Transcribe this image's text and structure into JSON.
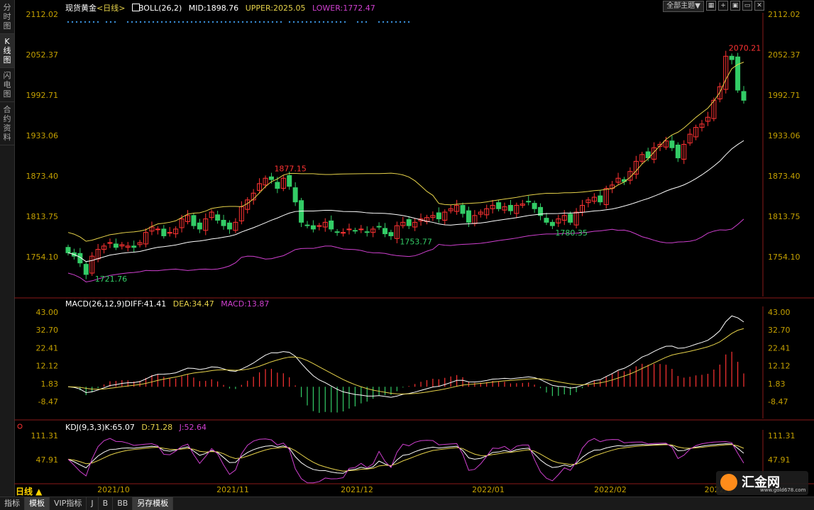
{
  "sidebar": {
    "tabs": [
      "分时图",
      "K线图",
      "闪电图",
      "合约资料"
    ],
    "active": 1
  },
  "header": {
    "symbol": "现货黄金",
    "period_tag": "<日线>",
    "boll_name": "BOLL(26,2)",
    "mid": "MID:1898.76",
    "upper": "UPPER:2025.05",
    "lower": "LOWER:1772.47"
  },
  "toolbar": {
    "theme_button": "全部主题▼",
    "icons": [
      "grid-icon",
      "add-icon",
      "restore-icon",
      "minimize-icon",
      "close-icon"
    ]
  },
  "price_axis": [
    "2112.02",
    "2052.37",
    "1992.71",
    "1933.06",
    "1873.40",
    "1813.75",
    "1754.10"
  ],
  "macd_header": {
    "name": "MACD(26,12,9)",
    "diff": "DIFF:41.41",
    "dea": "DEA:34.47",
    "macd": "MACD:13.87"
  },
  "macd_axis": [
    "43.00",
    "32.70",
    "22.41",
    "12.12",
    "1.83",
    "-8.47"
  ],
  "kdj_header": {
    "name": "KDJ(9,3,3)",
    "k": "K:65.07",
    "d": "D:71.28",
    "j": "J:52.64"
  },
  "kdj_axis": [
    "111.31",
    "47.91"
  ],
  "date_axis": [
    "2021/10",
    "2021/11",
    "2021/12",
    "2022/01",
    "2022/02",
    "2022/0"
  ],
  "annotations": [
    "1721.76",
    "1877.15",
    "1753.77",
    "1780.35",
    "2070.21"
  ],
  "period_button": "日线 ▲",
  "bottom_tabs": [
    "指标",
    "模板",
    "VIP指标",
    "J",
    "B",
    "BB",
    "另存模板"
  ],
  "logo": {
    "text": "汇金网",
    "url_text": "www.gold678.com"
  },
  "colors": {
    "up": "#ff3333",
    "down": "#33cc66",
    "mid": "#ffffff",
    "upper": "#e6d24a",
    "lower": "#d040d0",
    "axis": "#c4a000"
  },
  "chart_data": {
    "type": "candlestick",
    "x": [
      "2021/10",
      "2021/11",
      "2021/12",
      "2022/01",
      "2022/02"
    ],
    "ylim": [
      1730,
      2120
    ],
    "close": [
      1760,
      1755,
      1745,
      1728,
      1755,
      1765,
      1770,
      1775,
      1768,
      1772,
      1770,
      1768,
      1775,
      1790,
      1798,
      1795,
      1785,
      1790,
      1795,
      1810,
      1815,
      1800,
      1795,
      1810,
      1820,
      1808,
      1800,
      1795,
      1805,
      1828,
      1838,
      1848,
      1862,
      1870,
      1868,
      1855,
      1870,
      1858,
      1835,
      1805,
      1800,
      1795,
      1800,
      1805,
      1795,
      1790,
      1790,
      1795,
      1792,
      1795,
      1790,
      1795,
      1798,
      1788,
      1785,
      1800,
      1805,
      1800,
      1805,
      1810,
      1812,
      1815,
      1810,
      1820,
      1825,
      1830,
      1818,
      1805,
      1815,
      1820,
      1825,
      1830,
      1825,
      1828,
      1822,
      1830,
      1832,
      1835,
      1825,
      1815,
      1805,
      1800,
      1810,
      1815,
      1805,
      1820,
      1830,
      1838,
      1842,
      1835,
      1855,
      1860,
      1870,
      1865,
      1880,
      1895,
      1905,
      1900,
      1915,
      1920,
      1925,
      1915,
      1900,
      1920,
      1935,
      1945,
      1950,
      1960,
      1985,
      2005,
      2050,
      2045,
      2000,
      1985
    ],
    "macd_diff": 41.41,
    "macd_dea": 34.47,
    "macd_hist": 13.87,
    "kdj": {
      "k": 65.07,
      "d": 71.28,
      "j": 52.64
    }
  }
}
